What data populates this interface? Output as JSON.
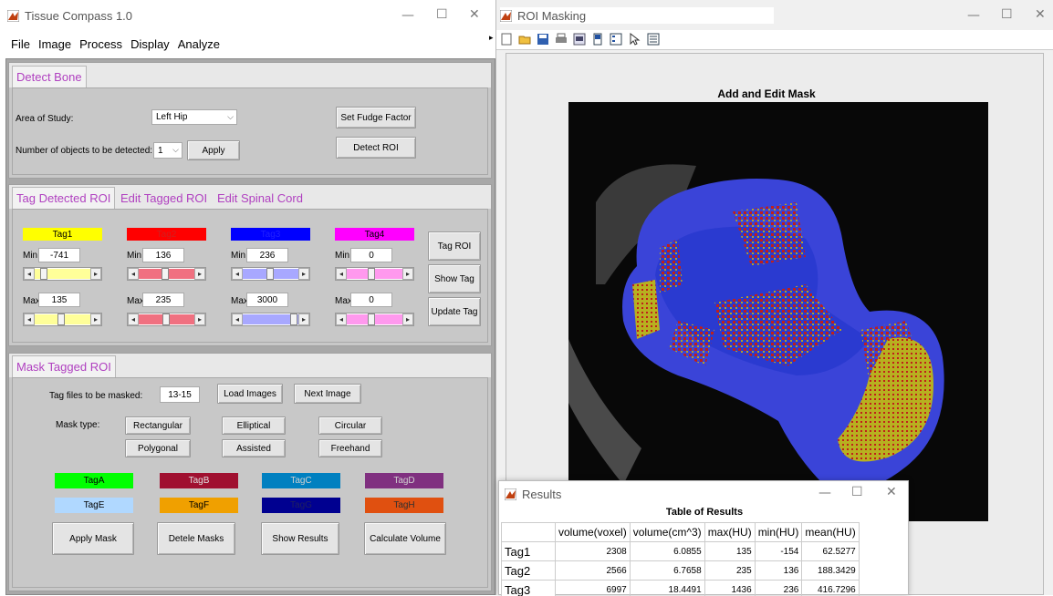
{
  "left_window": {
    "title": "Tissue Compass 1.0",
    "menu": [
      "File",
      "Image",
      "Process",
      "Display",
      "Analyze"
    ]
  },
  "detect_bone": {
    "tab": "Detect Bone",
    "area_label": "Area of Study:",
    "area_value": "Left Hip",
    "objects_label": "Number of objects to be detected:",
    "objects_value": "1",
    "apply_label": "Apply",
    "fudge_label": "Set Fudge Factor",
    "detect_label": "Detect ROI"
  },
  "tag_panel": {
    "tabs": [
      "Tag Detected ROI",
      "Edit Tagged ROI",
      "Edit Spinal Cord"
    ],
    "min_label": "Min:",
    "max_label": "Max:",
    "tags": [
      {
        "name": "Tag1",
        "color": "#ffff00",
        "min": "-741",
        "max": "135",
        "fill": "#ffff99",
        "min_pos": 0.1,
        "max_pos": 0.45
      },
      {
        "name": "Tag2",
        "color": "#ff0000",
        "min": "136",
        "max": "235",
        "fill": "#f07080",
        "min_pos": 0.45,
        "max_pos": 0.48
      },
      {
        "name": "Tag3",
        "color": "#0000ff",
        "min": "236",
        "max": "3000",
        "fill": "#a8a8ff",
        "min_pos": 0.48,
        "max_pos": 0.95
      },
      {
        "name": "Tag4",
        "color": "#ff00ff",
        "min": "0",
        "max": "0",
        "fill": "#ff99ee",
        "min_pos": 0.42,
        "max_pos": 0.42
      }
    ],
    "tag_roi_label": "Tag ROI",
    "show_tag_label": "Show Tag",
    "update_tag_label": "Update Tag"
  },
  "mask_panel": {
    "tab": "Mask Tagged ROI",
    "files_label": "Tag files to be masked:",
    "files_value": "13-15",
    "load_label": "Load Images",
    "next_label": "Next Image",
    "mask_type_label": "Mask type:",
    "types": [
      "Rectangular",
      "Elliptical",
      "Circular",
      "Polygonal",
      "Assisted",
      "Freehand"
    ],
    "color_tags": [
      {
        "name": "TagA",
        "color": "#00ff00",
        "text": "#000000"
      },
      {
        "name": "TagB",
        "color": "#a01030",
        "text": "#e0e0e0"
      },
      {
        "name": "TagC",
        "color": "#0080c0",
        "text": "#d0d0d0"
      },
      {
        "name": "TagD",
        "color": "#803080",
        "text": "#d0d0d0"
      },
      {
        "name": "TagE",
        "color": "#b0d8ff",
        "text": "#000000"
      },
      {
        "name": "TagF",
        "color": "#f0a000",
        "text": "#000000"
      },
      {
        "name": "TagG",
        "color": "#000090",
        "text": "#202060"
      },
      {
        "name": "TagH",
        "color": "#e05010",
        "text": "#303030"
      }
    ],
    "apply_mask_label": "Apply Mask",
    "delete_label": "Detele Masks",
    "show_results_label": "Show Results",
    "calc_label": "Calculate Volume"
  },
  "right_window": {
    "title": "ROI Masking",
    "plot_title": "Add and Edit Mask"
  },
  "results": {
    "title": "Results",
    "table_title": "Table of Results",
    "columns": [
      "volume(voxel)",
      "volume(cm^3)",
      "max(HU)",
      "min(HU)",
      "mean(HU)"
    ],
    "rows": [
      {
        "name": "Tag1",
        "cells": [
          "2308",
          "6.0855",
          "135",
          "-154",
          "62.5277"
        ]
      },
      {
        "name": "Tag2",
        "cells": [
          "2566",
          "6.7658",
          "235",
          "136",
          "188.3429"
        ]
      },
      {
        "name": "Tag3",
        "cells": [
          "6997",
          "18.4491",
          "1436",
          "236",
          "416.7296"
        ]
      }
    ]
  }
}
